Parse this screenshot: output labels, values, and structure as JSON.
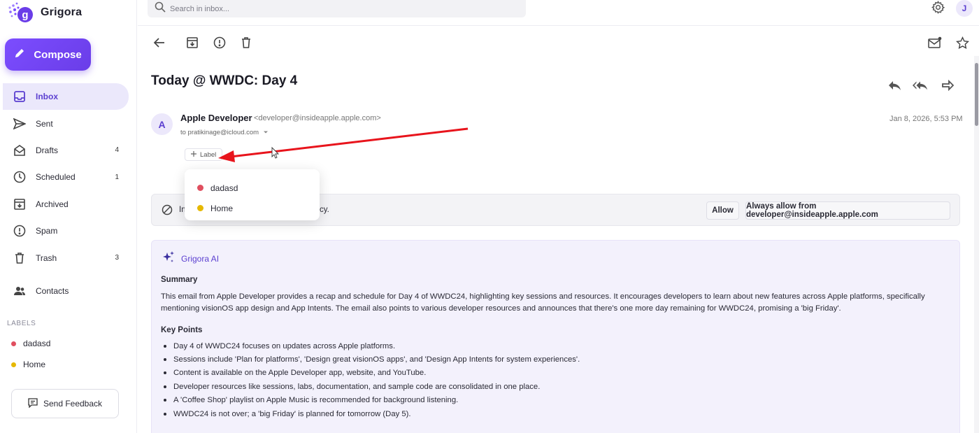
{
  "app": {
    "name": "Grigora"
  },
  "compose": {
    "label": "Compose"
  },
  "search": {
    "placeholder": "Search in inbox..."
  },
  "user": {
    "initial": "J"
  },
  "nav": [
    {
      "label": "Inbox",
      "count": ""
    },
    {
      "label": "Sent",
      "count": ""
    },
    {
      "label": "Drafts",
      "count": "4"
    },
    {
      "label": "Scheduled",
      "count": "1"
    },
    {
      "label": "Archived",
      "count": ""
    },
    {
      "label": "Spam",
      "count": ""
    },
    {
      "label": "Trash",
      "count": "3"
    }
  ],
  "contacts": {
    "label": "Contacts"
  },
  "labels": {
    "heading": "LABELS",
    "items": [
      {
        "name": "dadasd",
        "color": "#e04f5f"
      },
      {
        "name": "Home",
        "color": "#e6b800"
      }
    ]
  },
  "feedback": {
    "label": "Send Feedback"
  },
  "email": {
    "subject": "Today @ WWDC: Day 4",
    "sender_initial": "A",
    "sender_name": "Apple Developer",
    "sender_email": "<developer@insideapple.apple.com>",
    "to": "to pratikinage@icloud.com",
    "date": "Jan 8, 2026, 5:53 PM",
    "label_button": "Label"
  },
  "label_dropdown": [
    {
      "name": "dadasd",
      "color": "#e04f5f"
    },
    {
      "name": "Home",
      "color": "#e6b800"
    }
  ],
  "remote_images": {
    "text_start": "In",
    "text_end": "cy.",
    "allow_label": "Allow",
    "always_allow_label": "Always allow from developer@insideapple.apple.com"
  },
  "ai": {
    "title": "Grigora AI",
    "summary_heading": "Summary",
    "summary": "This email from Apple Developer provides a recap and schedule for Day 4 of WWDC24, highlighting key sessions and resources. It encourages developers to learn about new features across Apple platforms, specifically mentioning visionOS app design and App Intents. The email also points to various developer resources and announces that there's one more day remaining for WWDC24, promising a 'big Friday'.",
    "key_points_heading": "Key Points",
    "key_points": [
      "Day 4 of WWDC24 focuses on updates across Apple platforms.",
      "Sessions include 'Plan for platforms', 'Design great visionOS apps', and 'Design App Intents for system experiences'.",
      "Content is available on the Apple Developer app, website, and YouTube.",
      "Developer resources like sessions, labs, documentation, and sample code are consolidated in one place.",
      "A 'Coffee Shop' playlist on Apple Music is recommended for background listening.",
      "WWDC24 is not over; a 'big Friday' is planned for tomorrow (Day 5)."
    ]
  },
  "colors": {
    "accent": "#6a3de8",
    "annotation_arrow": "#e8141c"
  }
}
